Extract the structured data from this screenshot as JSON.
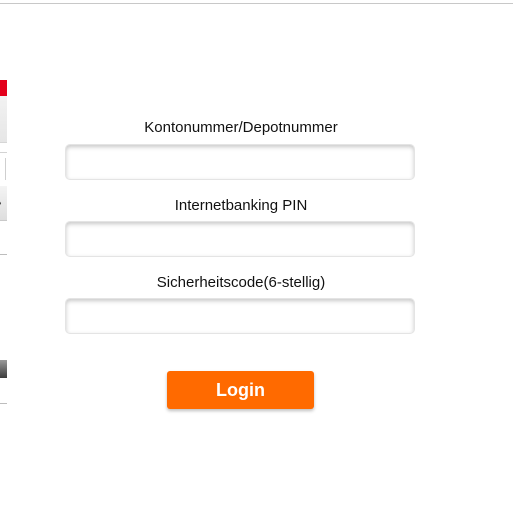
{
  "login_form": {
    "account_label": "Kontonummer/Depotnummer",
    "account_value": "",
    "pin_label": "Internetbanking PIN",
    "pin_value": "",
    "code_label": "Sicherheitscode(6-stellig)",
    "code_value": "",
    "login_label": "Login"
  },
  "colors": {
    "login_button": "#ff6a00",
    "brand_red": "#e3001b"
  }
}
